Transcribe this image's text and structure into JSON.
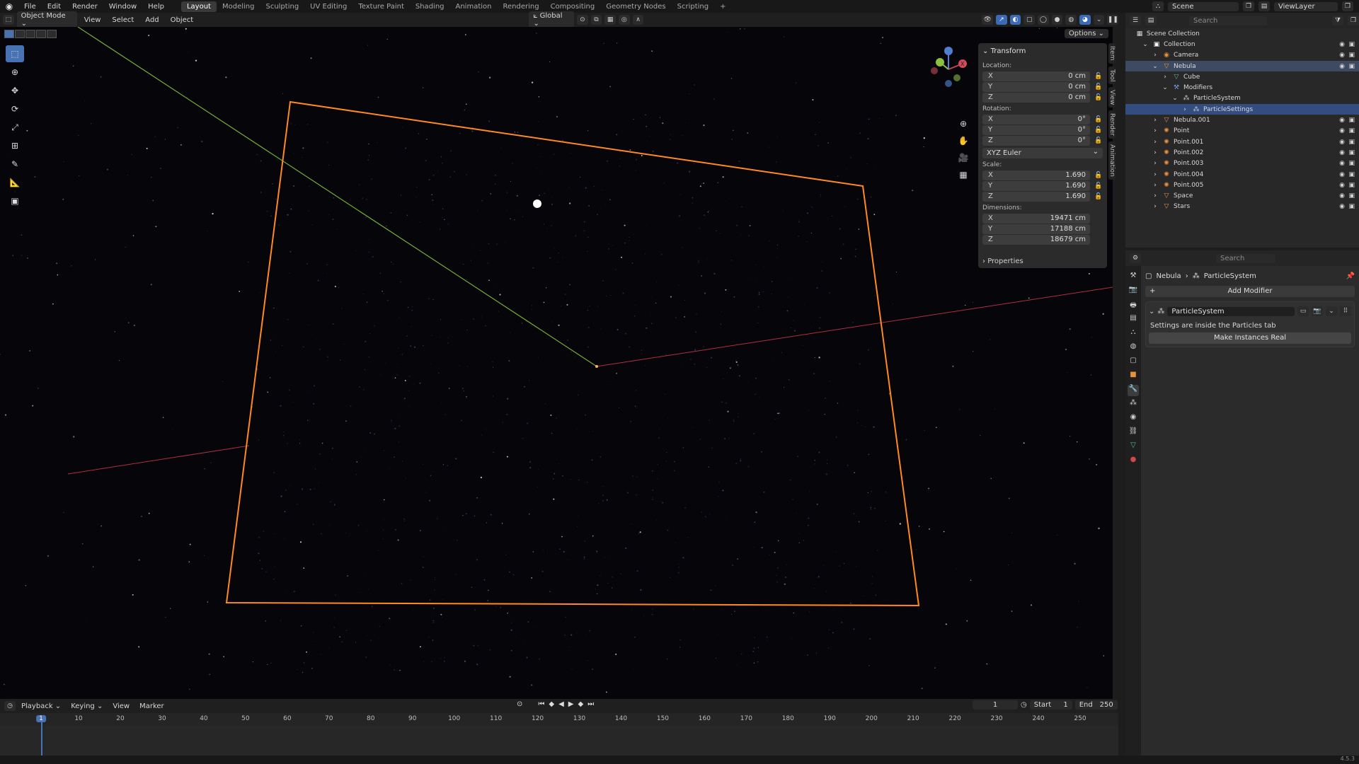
{
  "topbar": {
    "menus": [
      "File",
      "Edit",
      "Render",
      "Window",
      "Help"
    ],
    "workspaces": [
      "Layout",
      "Modeling",
      "Sculpting",
      "UV Editing",
      "Texture Paint",
      "Shading",
      "Animation",
      "Rendering",
      "Compositing",
      "Geometry Nodes",
      "Scripting"
    ],
    "active_workspace": "Layout",
    "add_tab": "+",
    "scene_name": "Scene",
    "view_layer": "ViewLayer"
  },
  "viewport_header": {
    "mode": "Object Mode",
    "menus": [
      "View",
      "Select",
      "Add",
      "Object"
    ],
    "orientation": "Global",
    "options_label": "Options"
  },
  "transform_panel": {
    "title": "Transform",
    "location_label": "Location:",
    "location": [
      {
        "axis": "X",
        "value": "0 cm"
      },
      {
        "axis": "Y",
        "value": "0 cm"
      },
      {
        "axis": "Z",
        "value": "0 cm"
      }
    ],
    "rotation_label": "Rotation:",
    "rotation": [
      {
        "axis": "X",
        "value": "0°"
      },
      {
        "axis": "Y",
        "value": "0°"
      },
      {
        "axis": "Z",
        "value": "0°"
      }
    ],
    "rotation_mode": "XYZ Euler",
    "scale_label": "Scale:",
    "scale": [
      {
        "axis": "X",
        "value": "1.690"
      },
      {
        "axis": "Y",
        "value": "1.690"
      },
      {
        "axis": "Z",
        "value": "1.690"
      }
    ],
    "dimensions_label": "Dimensions:",
    "dimensions": [
      {
        "axis": "X",
        "value": "19471 cm"
      },
      {
        "axis": "Y",
        "value": "17188 cm"
      },
      {
        "axis": "Z",
        "value": "18679 cm"
      }
    ],
    "properties_label": "Properties"
  },
  "side_tabs": [
    "Item",
    "Tool",
    "View",
    "Render",
    "Animation"
  ],
  "outliner": {
    "search_placeholder": "Search",
    "scene_collection": "Scene Collection",
    "rows": [
      {
        "label": "Collection",
        "indent": 1,
        "icon": "collection-icon",
        "glyph": "▣",
        "color": "#ffffff"
      },
      {
        "label": "Camera",
        "indent": 2,
        "icon": "camera-icon",
        "glyph": "◉",
        "color": "#e8913b"
      },
      {
        "label": "Nebula",
        "indent": 2,
        "icon": "mesh-icon",
        "glyph": "▽",
        "color": "#e8913b"
      },
      {
        "label": "Cube",
        "indent": 3,
        "icon": "mesh-data-icon",
        "glyph": "▽",
        "color": "#53c18c"
      },
      {
        "label": "Modifiers",
        "indent": 3,
        "icon": "wrench-icon",
        "glyph": "⚒",
        "color": "#6fa0e0"
      },
      {
        "label": "ParticleSystem",
        "indent": 4,
        "icon": "particles-icon",
        "glyph": "⁂",
        "color": "#cfcfcf"
      },
      {
        "label": "ParticleSettings",
        "indent": 5,
        "icon": "particle-settings-icon",
        "glyph": "⁂",
        "color": "#cfcfcf"
      },
      {
        "label": "Nebula.001",
        "indent": 2,
        "icon": "mesh-icon",
        "glyph": "▽",
        "color": "#e8913b"
      },
      {
        "label": "Point",
        "indent": 2,
        "icon": "light-icon",
        "glyph": "✺",
        "color": "#e8913b"
      },
      {
        "label": "Point.001",
        "indent": 2,
        "icon": "light-icon",
        "glyph": "✺",
        "color": "#e8913b"
      },
      {
        "label": "Point.002",
        "indent": 2,
        "icon": "light-icon",
        "glyph": "✺",
        "color": "#e8913b"
      },
      {
        "label": "Point.003",
        "indent": 2,
        "icon": "light-icon",
        "glyph": "✺",
        "color": "#e8913b"
      },
      {
        "label": "Point.004",
        "indent": 2,
        "icon": "light-icon",
        "glyph": "✺",
        "color": "#e8913b"
      },
      {
        "label": "Point.005",
        "indent": 2,
        "icon": "light-icon",
        "glyph": "✺",
        "color": "#e8913b"
      },
      {
        "label": "Space",
        "indent": 2,
        "icon": "mesh-icon",
        "glyph": "▽",
        "color": "#e8913b"
      },
      {
        "label": "Stars",
        "indent": 2,
        "icon": "mesh-icon",
        "glyph": "▽",
        "color": "#e8913b"
      }
    ]
  },
  "properties": {
    "search_placeholder": "Search",
    "breadcrumb": [
      "Nebula",
      "ParticleSystem"
    ],
    "add_modifier": "Add Modifier",
    "modifier_name": "ParticleSystem",
    "modifier_info": "Settings are inside the Particles tab",
    "make_real_button": "Make Instances Real"
  },
  "timeline": {
    "menus": [
      "Playback",
      "Keying",
      "View",
      "Marker"
    ],
    "current_frame": "1",
    "start_label": "Start",
    "start": "1",
    "end_label": "End",
    "end": "250",
    "ticks": [
      "1",
      "10",
      "20",
      "30",
      "40",
      "50",
      "60",
      "70",
      "80",
      "90",
      "100",
      "110",
      "120",
      "130",
      "140",
      "150",
      "160",
      "170",
      "180",
      "190",
      "200",
      "210",
      "220",
      "230",
      "240",
      "250"
    ]
  },
  "statusbar": {
    "version": "4.5.3"
  },
  "colors": {
    "accent": "#4772b3",
    "selection_outline": "#ff8a1f",
    "x_axis": "#c0394a",
    "y_axis": "#7dbb33"
  }
}
